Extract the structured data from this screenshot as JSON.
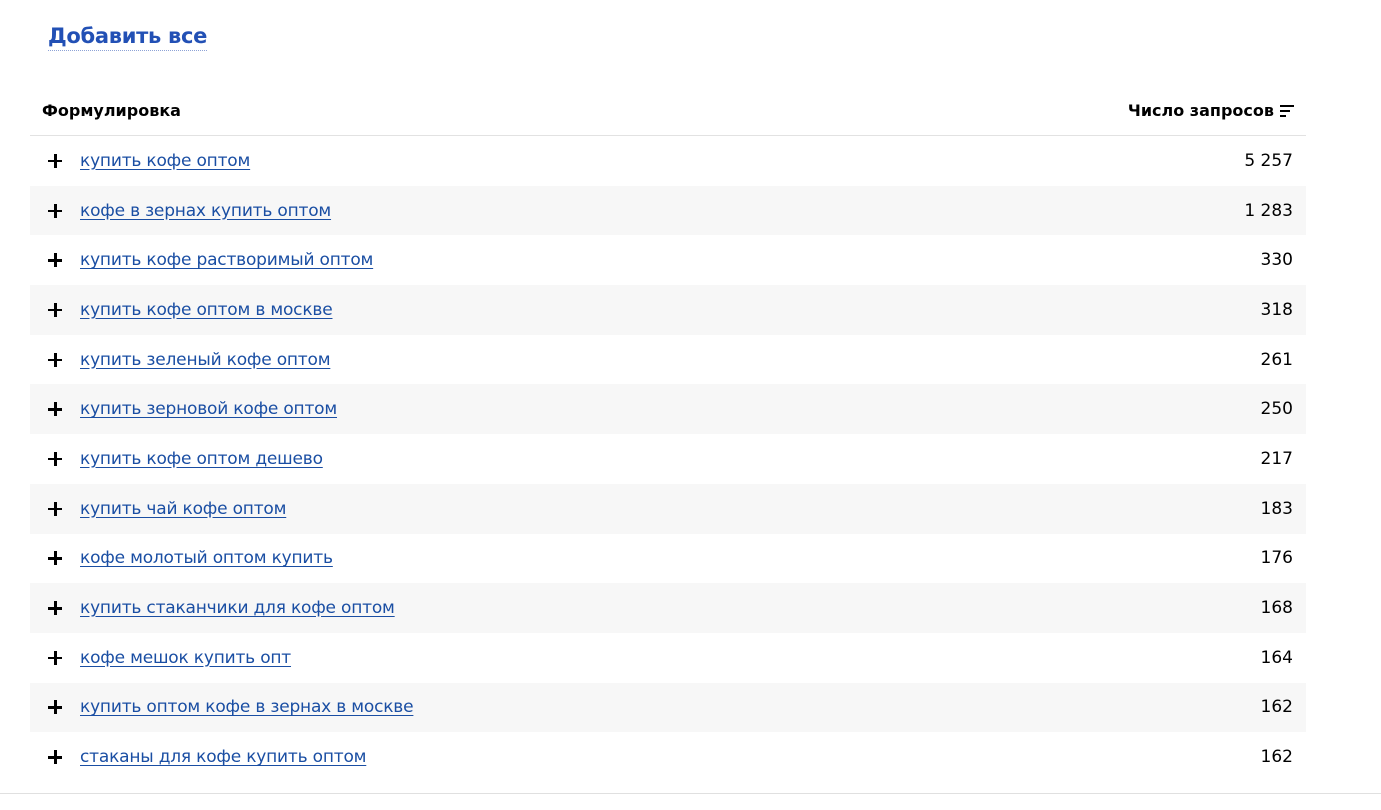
{
  "header": {
    "add_all_label": "Добавить все"
  },
  "table": {
    "columns": {
      "phrase": "Формулировка",
      "count": "Число запросов"
    },
    "rows": [
      {
        "phrase": "купить кофе оптом",
        "count": "5 257"
      },
      {
        "phrase": "кофе в зернах купить оптом",
        "count": "1 283"
      },
      {
        "phrase": "купить кофе растворимый оптом",
        "count": "330"
      },
      {
        "phrase": "купить кофе оптом в москве",
        "count": "318"
      },
      {
        "phrase": "купить зеленый кофе оптом",
        "count": "261"
      },
      {
        "phrase": "купить зерновой кофе оптом",
        "count": "250"
      },
      {
        "phrase": "купить кофе оптом дешево",
        "count": "217"
      },
      {
        "phrase": "купить чай кофе оптом",
        "count": "183"
      },
      {
        "phrase": "кофе молотый оптом купить",
        "count": "176"
      },
      {
        "phrase": "купить стаканчики для кофе оптом",
        "count": "168"
      },
      {
        "phrase": "кофе мешок купить опт",
        "count": "164"
      },
      {
        "phrase": "купить оптом кофе в зернах в москве",
        "count": "162"
      },
      {
        "phrase": "стаканы для кофе купить оптом",
        "count": "162"
      }
    ]
  },
  "icons": {
    "add": "plus-icon",
    "sort": "sort-desc-icon"
  },
  "colors": {
    "link": "#1a4ea3",
    "add_all": "#2250b5",
    "row_alt": "#f7f7f7"
  }
}
